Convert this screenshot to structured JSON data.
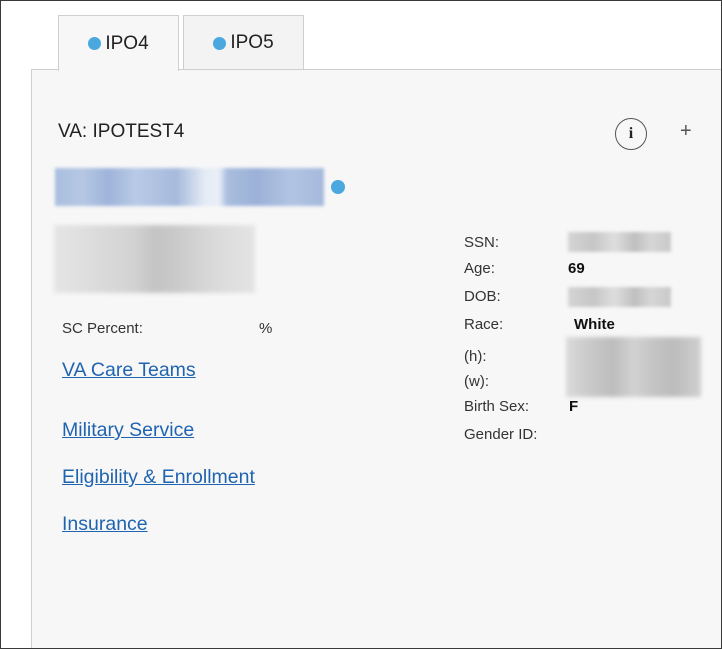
{
  "tabs": [
    {
      "label": "IPO4",
      "active": true
    },
    {
      "label": "IPO5",
      "active": false
    }
  ],
  "patient": {
    "title": "VA: IPOTEST4",
    "info_icon_glyph": "i",
    "plus_icon_glyph": "+",
    "sc_percent_label": "SC Percent:",
    "sc_percent_unit": "%"
  },
  "links": {
    "care_teams": "VA Care Teams",
    "military_service": "Military Service",
    "eligibility": "Eligibility & Enrollment",
    "insurance": "Insurance"
  },
  "demographics": {
    "ssn_label": "SSN:",
    "age_label": "Age:",
    "age_value": "69",
    "dob_label": "DOB:",
    "race_label": "Race:",
    "race_value": "White",
    "home_phone_label": "(h):",
    "work_phone_label": "(w):",
    "birth_sex_label": "Birth Sex:",
    "birth_sex_value": "F",
    "gender_id_label": "Gender ID:"
  },
  "icons": {
    "status_dot_color": "#4aa8de",
    "info": "info-icon",
    "add": "plus-icon"
  },
  "colors": {
    "link": "#1f64b0",
    "panel_bg": "#f7f7f7"
  }
}
